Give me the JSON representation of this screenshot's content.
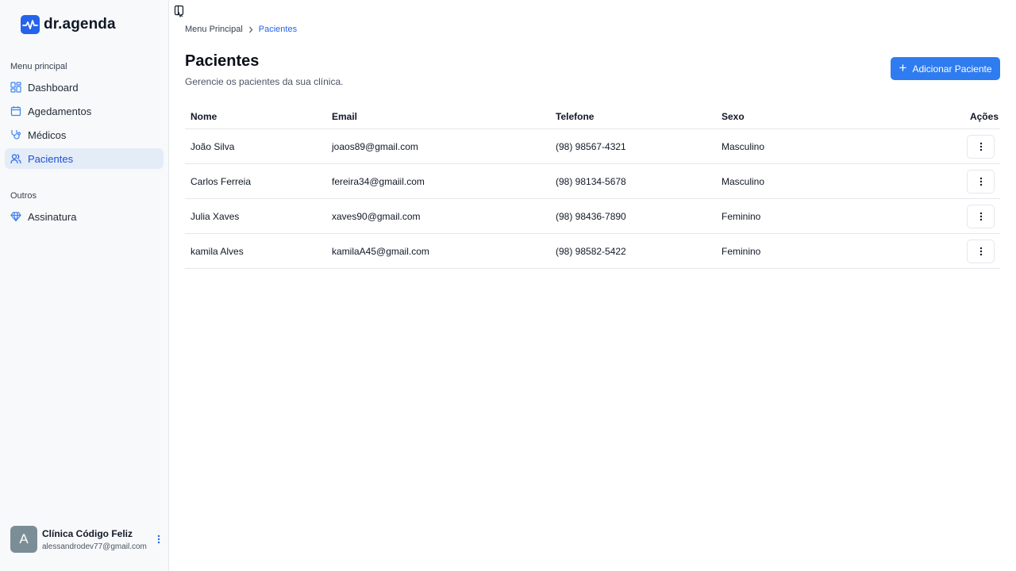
{
  "app": {
    "name": "dr.agenda",
    "brand_color": "#2563eb"
  },
  "sidebar": {
    "main_group_label": "Menu principal",
    "items": [
      {
        "label": "Dashboard",
        "icon": "layout-dashboard-icon"
      },
      {
        "label": "Agedamentos",
        "icon": "calendar-icon"
      },
      {
        "label": "Médicos",
        "icon": "stethoscope-icon"
      },
      {
        "label": "Pacientes",
        "icon": "users-icon",
        "active": true
      }
    ],
    "other_group_label": "Outros",
    "other_items": [
      {
        "label": "Assinatura",
        "icon": "gem-icon"
      }
    ],
    "user": {
      "initial": "A",
      "name": "Clínica Código Feliz",
      "email": "alessandrodev77@gmail.com"
    }
  },
  "breadcrumb": {
    "root": "Menu Principal",
    "current": "Pacientes"
  },
  "page": {
    "title": "Pacientes",
    "subtitle": "Gerencie os pacientes da sua clínica.",
    "add_button": "Adicionar Paciente"
  },
  "table": {
    "headers": {
      "name": "Nome",
      "email": "Email",
      "phone": "Telefone",
      "sex": "Sexo",
      "actions": "Ações"
    },
    "rows": [
      {
        "name": "João Silva",
        "email": "joaos89@gmail.com",
        "phone": "(98) 98567-4321",
        "sex": "Masculino"
      },
      {
        "name": "Carlos Ferreia",
        "email": "fereira34@gmaiil.com",
        "phone": "(98) 98134-5678",
        "sex": "Masculino"
      },
      {
        "name": "Julia Xaves",
        "email": "xaves90@gmail.com",
        "phone": "(98) 98436-7890",
        "sex": "Feminino"
      },
      {
        "name": "kamila Alves",
        "email": "kamilaA45@gmail.com",
        "phone": "(98) 98582-5422",
        "sex": "Feminino"
      }
    ]
  }
}
